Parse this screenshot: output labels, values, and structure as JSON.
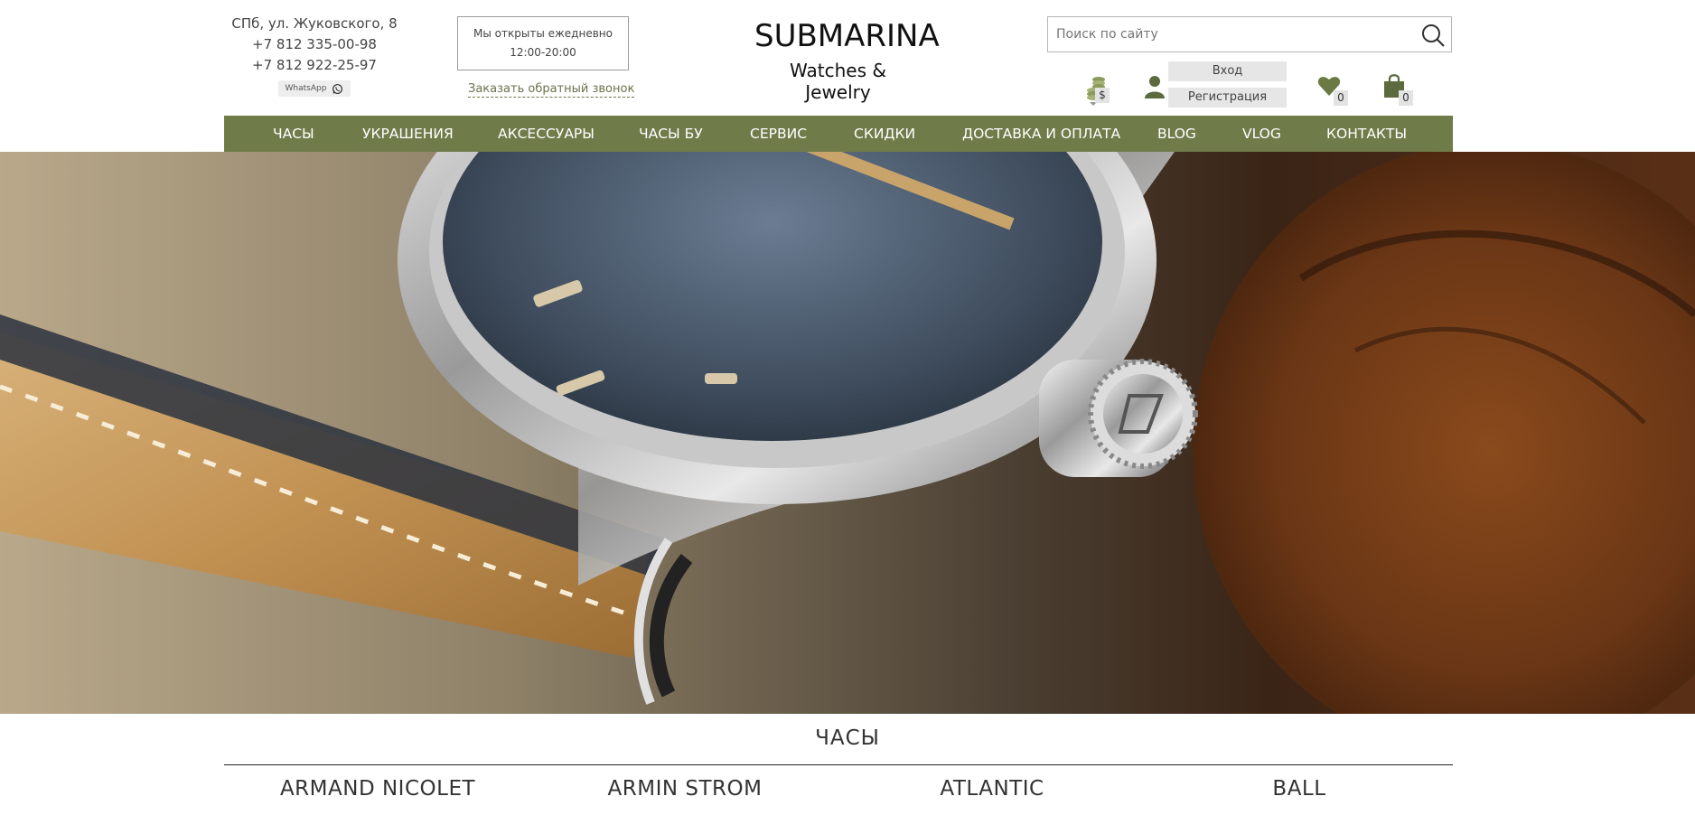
{
  "header": {
    "address": "СПб, ул. Жуковского, 8",
    "phone1": "+7 812 335-00-98",
    "phone2": "+7 812 922-25-97",
    "whatsapp_label": "WhatsApp",
    "hours_line1": "Мы открыты ежедневно",
    "hours_line2": "12:00-20:00",
    "callback_label": "Заказать обратный звонок",
    "logo_main": "SUBMARINA",
    "logo_sub": "Watches & Jewelry",
    "search_placeholder": "Поиск по сайту",
    "login_label": "Вход",
    "register_label": "Регистрация",
    "currency_symbol": "$",
    "favorites_count": "0",
    "cart_count": "0"
  },
  "nav": {
    "items": [
      "ЧАСЫ",
      "УКРАШЕНИЯ",
      "АКСЕССУАРЫ",
      "ЧАСЫ БУ",
      "СЕРВИС",
      "СКИДКИ",
      "ДОСТАВКА И ОПЛАТА",
      "BLOG",
      "VLOG",
      "КОНТАКТЫ"
    ]
  },
  "section": {
    "title": "ЧАСЫ",
    "brands": [
      "ARMAND NICOLET",
      "ARMIN STROM",
      "ATLANTIC",
      "BALL"
    ]
  },
  "colors": {
    "accent": "#6f7c4a",
    "link": "#6a7249"
  },
  "icons": [
    "whatsapp-icon",
    "search-icon",
    "currency-coins-icon",
    "user-icon",
    "heart-icon",
    "shopping-bag-icon"
  ]
}
